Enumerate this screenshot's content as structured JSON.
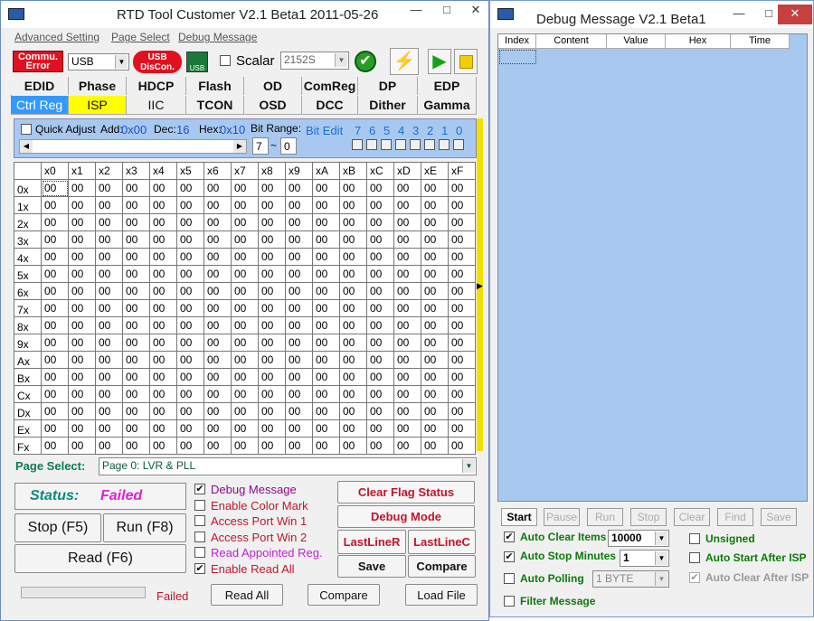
{
  "main_window": {
    "title": "RTD Tool Customer V2.1 Beta1   2011-05-26",
    "menu": [
      "Advanced Setting",
      "Page Select",
      "Debug Message"
    ],
    "commu_error": "Commu. Error",
    "interface_value": "USB",
    "usb_disconnect": "USB DisCon.",
    "scalar_label": "Scalar",
    "scalar_value": "2152S",
    "tabs_row1": [
      "EDID",
      "Phase",
      "HDCP",
      "Flash",
      "OD",
      "ComReg",
      "DP",
      "EDP"
    ],
    "tabs_row2": [
      "Ctrl Reg",
      "ISP",
      "IIC",
      "TCON",
      "OSD",
      "DCC",
      "Dither",
      "Gamma"
    ],
    "quick_adjust": "Quick Adjust",
    "add_label": "Add:",
    "add_value": "0x00",
    "dec_label": "Dec:",
    "dec_value": "16",
    "hex_label": "Hex:",
    "hex_value": "0x10",
    "bit_range_label": "Bit Range:",
    "bit_range_from": "7",
    "bit_range_sep": "~",
    "bit_range_to": "0",
    "bit_edit_label": "Bit Edit",
    "bit_numbers": [
      "7",
      "6",
      "5",
      "4",
      "3",
      "2",
      "1",
      "0"
    ],
    "columns": [
      "x0",
      "x1",
      "x2",
      "x3",
      "x4",
      "x5",
      "x6",
      "x7",
      "x8",
      "x9",
      "xA",
      "xB",
      "xC",
      "xD",
      "xE",
      "xF"
    ],
    "rows": [
      "0x",
      "1x",
      "2x",
      "3x",
      "4x",
      "5x",
      "6x",
      "7x",
      "8x",
      "9x",
      "Ax",
      "Bx",
      "Cx",
      "Dx",
      "Ex",
      "Fx"
    ],
    "cell_value": "00",
    "page_select_label": "Page Select:",
    "page_select_value": "Page 0: LVR & PLL",
    "status_label": "Status:",
    "status_value": "Failed",
    "stop_button": "Stop (F5)",
    "run_button": "Run (F8)",
    "read_button": "Read (F6)",
    "options": [
      {
        "label": "Debug Message",
        "checked": true
      },
      {
        "label": "Enable Color Mark",
        "checked": false
      },
      {
        "label": "Access Port Win 1",
        "checked": false
      },
      {
        "label": "Access Port Win 2",
        "checked": false
      },
      {
        "label": "Read Appointed Reg.",
        "checked": false
      },
      {
        "label": "Enable Read All",
        "checked": true
      }
    ],
    "clear_flag": "Clear Flag Status",
    "debug_mode": "Debug Mode",
    "last_line_r": "LastLineR",
    "last_line_c": "LastLineC",
    "save": "Save",
    "compare": "Compare",
    "bottom_status": "Failed",
    "read_all": "Read All",
    "compare2": "Compare",
    "load_file": "Load File"
  },
  "debug_window": {
    "title": "Debug Message V2.1 Beta1",
    "columns": [
      "Index",
      "Content",
      "Value",
      "Hex",
      "Time"
    ],
    "buttons": [
      "Start",
      "Pause",
      "Run",
      "Stop",
      "Clear",
      "Find",
      "Save"
    ],
    "auto_clear_items": "Auto Clear Items",
    "auto_clear_value": "10000",
    "auto_stop_minutes": "Auto Stop Minutes",
    "auto_stop_value": "1",
    "auto_polling": "Auto Polling",
    "auto_polling_value": "1 BYTE",
    "filter_message": "Filter Message",
    "unsigned": "Unsigned",
    "auto_start_after_isp": "Auto Start After ISP",
    "auto_clear_after_isp": "Auto Clear After ISP"
  },
  "colors": {
    "accent_blue": "#3399ff",
    "panel_blue": "#a8c8f0",
    "red": "#c0162c",
    "green": "#0a7a0a"
  }
}
